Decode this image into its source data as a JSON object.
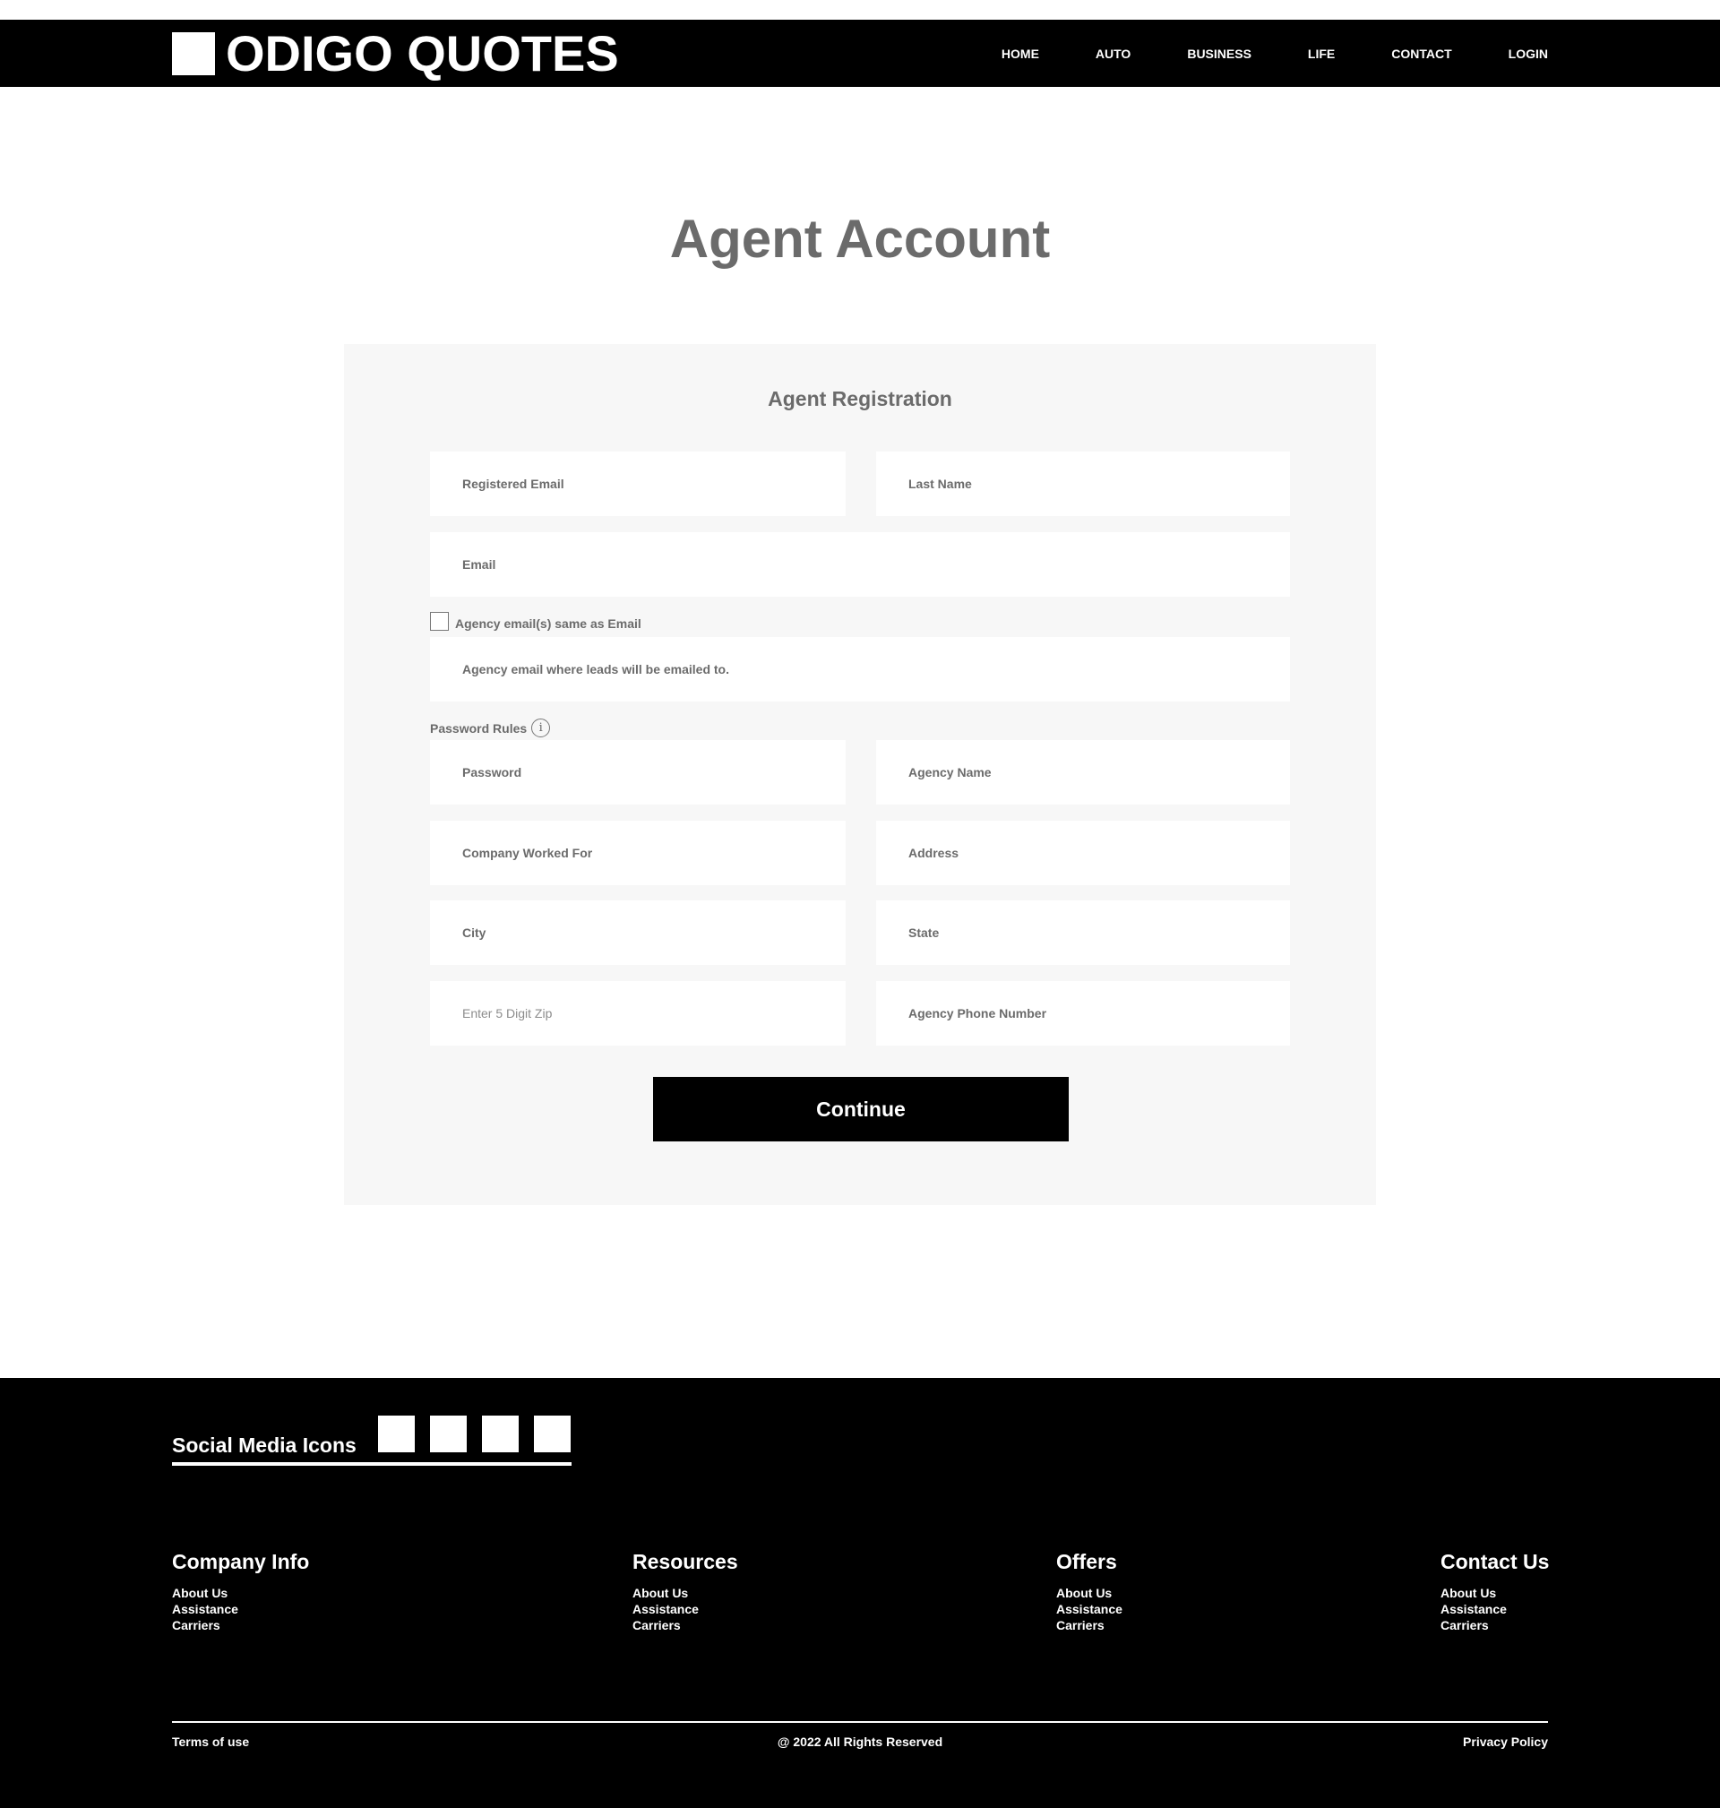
{
  "header": {
    "logo_text": "ODIGO QUOTES",
    "nav": [
      "HOME",
      "AUTO",
      "BUSINESS",
      "LIFE",
      "CONTACT",
      "LOGIN"
    ]
  },
  "page_title": "Agent Account",
  "form": {
    "title": "Agent Registration",
    "registered_email": "Registered Email",
    "last_name": "Last Name",
    "email": "Email",
    "agency_same_label": "Agency email(s) same as Email",
    "agency_email": "Agency email where leads will be emailed to.",
    "password_rules": "Password Rules",
    "password": "Password",
    "agency_name": "Agency Name",
    "company_worked_for": "Company Worked For",
    "address": "Address",
    "city": "City",
    "state": "State",
    "zip": "Enter 5 Digit Zip",
    "agency_phone": "Agency Phone Number",
    "continue": "Continue"
  },
  "footer": {
    "social_label": "Social Media Icons",
    "columns": [
      {
        "title": "Company Info",
        "links": [
          "About Us",
          "Assistance",
          "Carriers"
        ]
      },
      {
        "title": "Resources",
        "links": [
          "About Us",
          "Assistance",
          "Carriers"
        ]
      },
      {
        "title": "Offers",
        "links": [
          "About Us",
          "Assistance",
          "Carriers"
        ]
      },
      {
        "title": "Contact Us",
        "links": [
          "About Us",
          "Assistance",
          "Carriers"
        ]
      }
    ],
    "terms": "Terms of use",
    "copyright": "@ 2022 All Rights Reserved",
    "privacy": "Privacy Policy"
  }
}
